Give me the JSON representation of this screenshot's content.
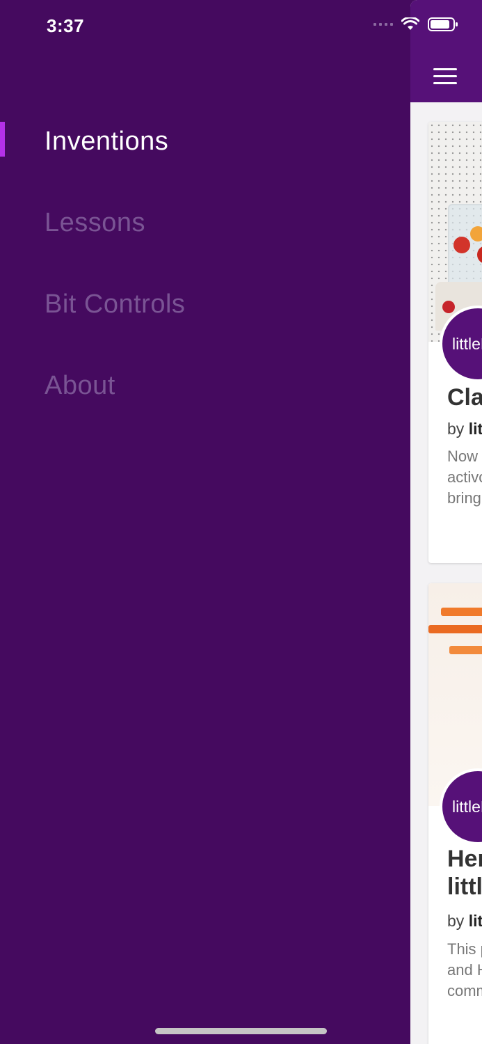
{
  "status_bar": {
    "time": "3:37"
  },
  "drawer": {
    "items": [
      {
        "label": "Inventions",
        "active": true
      },
      {
        "label": "Lessons",
        "active": false
      },
      {
        "label": "Bit Controls",
        "active": false
      },
      {
        "label": "About",
        "active": false
      }
    ]
  },
  "main": {
    "cards": [
      {
        "avatar_text": "littleBits",
        "title": "Cla",
        "by_prefix": "by",
        "by_author": "litt",
        "description_lines": [
          "Now",
          "activo",
          "bring"
        ]
      },
      {
        "avatar_text": "littleBits",
        "title_lines": [
          "Her",
          "little"
        ],
        "by_prefix": "by",
        "by_author": "litt",
        "description_lines": [
          "This p",
          "and H",
          "comm"
        ]
      }
    ]
  },
  "colors": {
    "drawer_bg": "#450a5f",
    "appbar_bg": "#561178",
    "active_indicator": "#b431e8",
    "inactive_text": "#7a5494"
  }
}
